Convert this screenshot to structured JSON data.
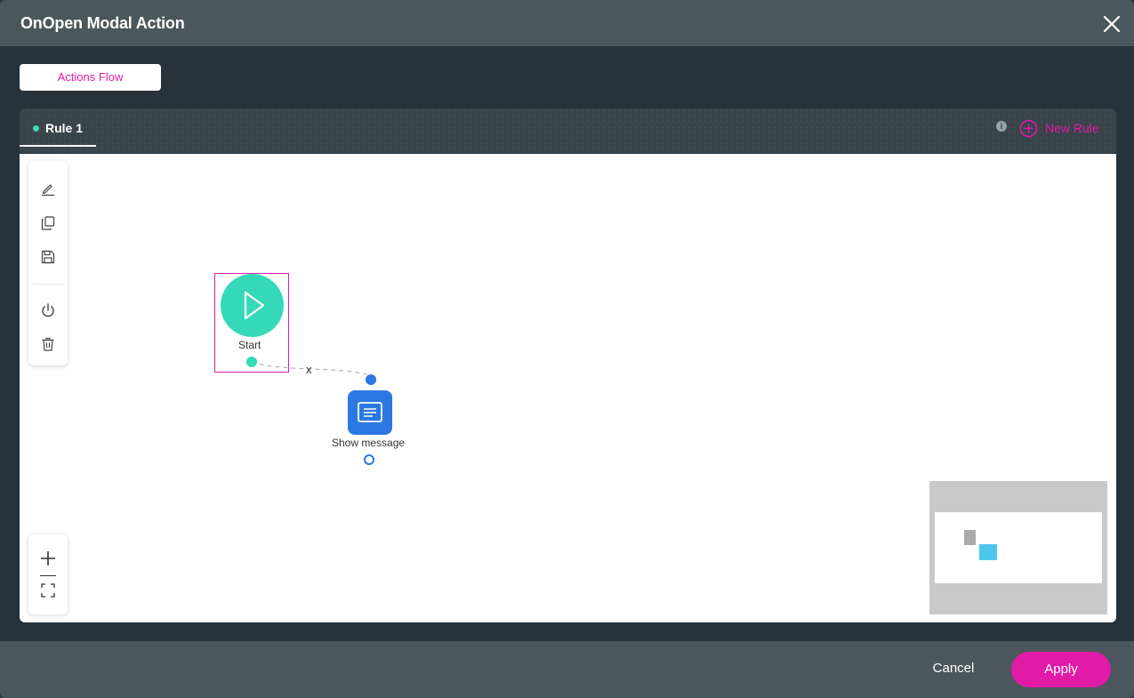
{
  "modal": {
    "title": "OnOpen Modal Action",
    "close_icon": "close-icon"
  },
  "tabs": {
    "actions_flow_label": "Actions Flow"
  },
  "rules": {
    "active_rule_label": "Rule 1",
    "info_icon": "info-icon",
    "info_glyph": "i",
    "new_rule_label": "New Rule",
    "new_rule_icon": "plus-circle-icon"
  },
  "toolbar": {
    "tools": [
      "edit-icon",
      "copy-icon",
      "save-icon",
      "power-icon",
      "trash-icon"
    ],
    "zoom_tools": [
      "zoom-in-icon",
      "fit-screen-icon"
    ]
  },
  "flow": {
    "start_node_label": "Start",
    "message_node_label": "Show message",
    "edge_remove_label": "x"
  },
  "footer": {
    "cancel_label": "Cancel",
    "apply_label": "Apply"
  },
  "colors": {
    "accent": "#e11ba7",
    "start_node": "#35d9b7",
    "message_node": "#2b78e4",
    "header_bg": "#4b575d",
    "body_bg": "#27323a"
  }
}
